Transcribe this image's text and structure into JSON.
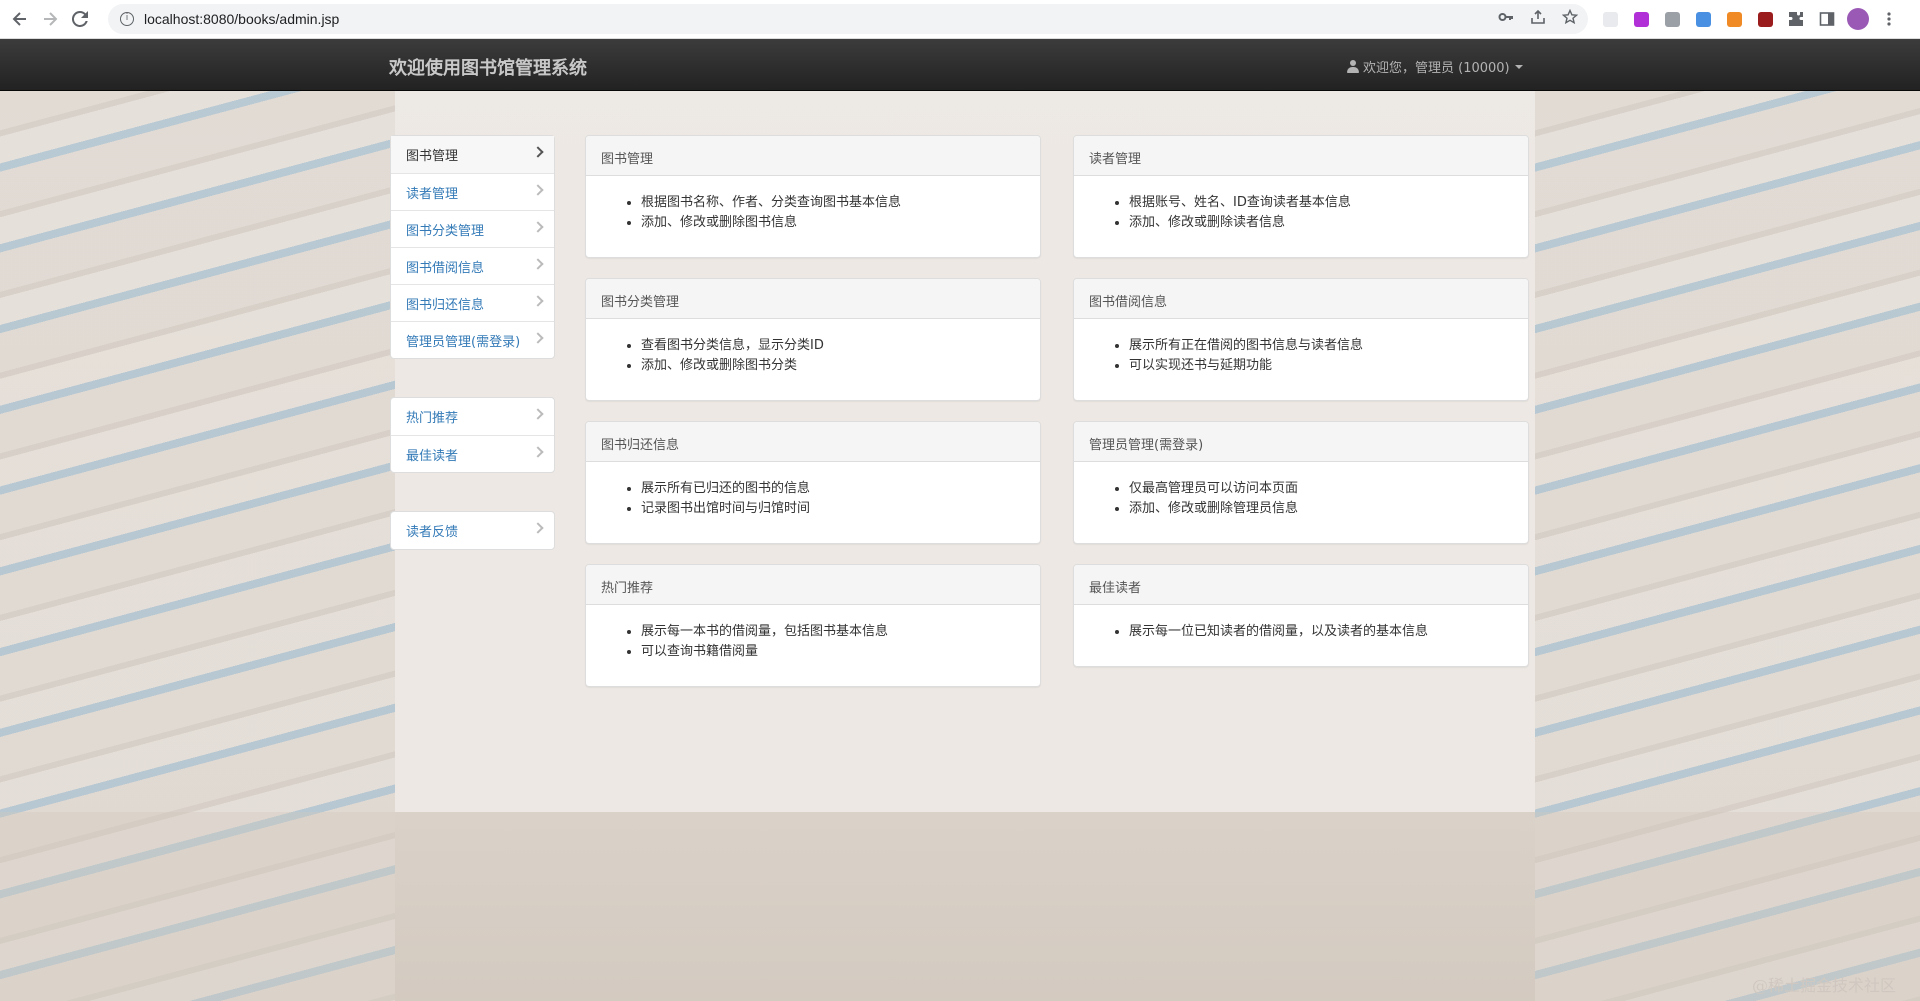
{
  "browser": {
    "url": "localhost:8080/books/admin.jsp",
    "info_glyph": "i",
    "back_icon": "back-arrow-icon",
    "forward_icon": "forward-arrow-icon",
    "reload_icon": "reload-icon"
  },
  "navbar": {
    "brand": "欢迎使用图书馆管理系统",
    "user_text": "欢迎您，管理员 (10000)"
  },
  "sidebar": {
    "group1": [
      {
        "label": "图书管理",
        "active": true
      },
      {
        "label": "读者管理"
      },
      {
        "label": "图书分类管理"
      },
      {
        "label": "图书借阅信息"
      },
      {
        "label": "图书归还信息"
      },
      {
        "label": "管理员管理(需登录)"
      }
    ],
    "group2": [
      {
        "label": "热门推荐"
      },
      {
        "label": "最佳读者"
      }
    ],
    "group3": [
      {
        "label": "读者反馈"
      }
    ]
  },
  "panels": [
    {
      "title": "图书管理",
      "items": [
        "根据图书名称、作者、分类查询图书基本信息",
        "添加、修改或删除图书信息"
      ]
    },
    {
      "title": "读者管理",
      "items": [
        "根据账号、姓名、ID查询读者基本信息",
        "添加、修改或删除读者信息"
      ]
    },
    {
      "title": "图书分类管理",
      "items": [
        "查看图书分类信息，显示分类ID",
        "添加、修改或删除图书分类"
      ]
    },
    {
      "title": "图书借阅信息",
      "items": [
        "展示所有正在借阅的图书信息与读者信息",
        "可以实现还书与延期功能"
      ]
    },
    {
      "title": "图书归还信息",
      "items": [
        "展示所有已归还的图书的信息",
        "记录图书出馆时间与归馆时间"
      ]
    },
    {
      "title": "管理员管理(需登录)",
      "items": [
        "仅最高管理员可以访问本页面",
        "添加、修改或删除管理员信息"
      ]
    },
    {
      "title": "热门推荐",
      "items": [
        "展示每一本书的借阅量，包括图书基本信息",
        "可以查询书籍借阅量"
      ]
    },
    {
      "title": "最佳读者",
      "items": [
        "展示每一位已知读者的借阅量，以及读者的基本信息"
      ]
    }
  ],
  "watermark": "@稀土掘金技术社区"
}
